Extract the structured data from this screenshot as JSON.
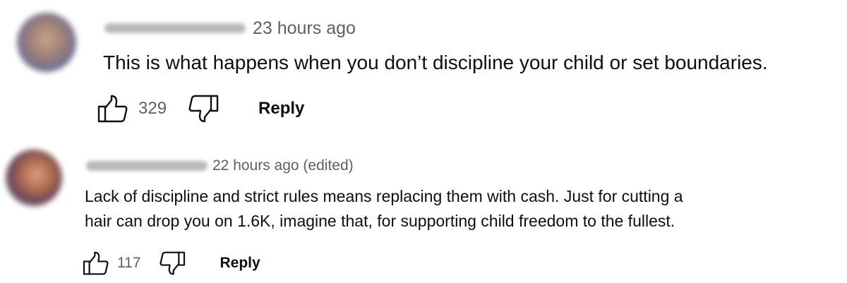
{
  "comments": [
    {
      "avatar_icon": "user-avatar-blurred",
      "handle_redacted": true,
      "timestamp": "23 hours ago",
      "text_lines": [
        "This is what happens when you don’t discipline your child or set boundaries."
      ],
      "like_count": "329",
      "reply_label": "Reply"
    },
    {
      "avatar_icon": "user-avatar-blurred",
      "handle_redacted": true,
      "timestamp": "22 hours ago (edited)",
      "text_lines": [
        "Lack of discipline and strict rules means replacing them with cash. Just for cutting a",
        "hair can drop you on 1.6K, imagine that, for supporting child freedom to the fullest."
      ],
      "like_count": "117",
      "reply_label": "Reply"
    }
  ],
  "icons": {
    "like": "thumbs-up-icon",
    "dislike": "thumbs-down-icon"
  },
  "colors": {
    "text_primary": "#0f0f0f",
    "text_secondary": "#606060",
    "background": "#ffffff"
  }
}
